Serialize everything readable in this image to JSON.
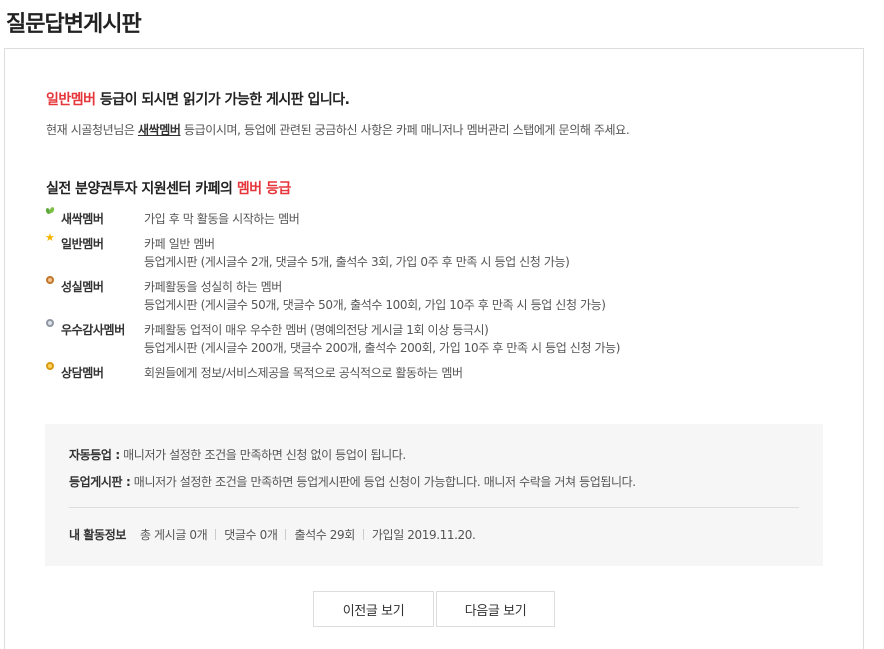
{
  "page": {
    "title": "질문답변게시판"
  },
  "notice": {
    "required_grade": "일반멤버",
    "title_suffix": " 등급이 되시면 읽기가 가능한 게시판 입니다.",
    "desc_prefix": "현재 시골청년님은 ",
    "current_grade": "새싹멤버",
    "desc_suffix": " 등급이시며, 등업에 관련된 궁금하신 사항은 카페 매니저나 멤버관리 스탭에게 문의해 주세요."
  },
  "grades": {
    "title_prefix": "실전 분양권투자 지원센터 카페의 ",
    "title_highlight": "멤버 등급",
    "items": [
      {
        "icon": "sprout-icon",
        "name": "새싹멤버",
        "line1": "가입 후 막 활동을 시작하는 멤버",
        "line2": ""
      },
      {
        "icon": "star-icon",
        "name": "일반멤버",
        "line1": "카페 일반 멤버",
        "line2": "등업게시판 (게시글수 2개, 댓글수 5개, 출석수 3회, 가입 0주 후 만족 시 등업 신청 가능)"
      },
      {
        "icon": "bronze-medal-icon",
        "name": "성실멤버",
        "line1": "카페활동을 성실히 하는 멤버",
        "line2": "등업게시판 (게시글수 50개, 댓글수 50개, 출석수 100회, 가입 10주 후 만족 시 등업 신청 가능)"
      },
      {
        "icon": "silver-medal-icon",
        "name": "우수감사멤버",
        "line1": "카페활동 업적이 매우 우수한 멤버 (명예의전당 게시글 1회 이상 등극시)",
        "line2": "등업게시판 (게시글수 200개, 댓글수 200개, 출석수 200회, 가입 10주 후 만족 시 등업 신청 가능)"
      },
      {
        "icon": "gold-medal-icon",
        "name": "상담멤버",
        "line1": "회원들에게 정보/서비스제공을 목적으로 공식적으로 활동하는 멤버",
        "line2": ""
      }
    ]
  },
  "info": {
    "auto_label": "자동등업 :",
    "auto_text": " 매니저가 설정한 조건을 만족하면 신청 없이 등업이 됩니다.",
    "board_label": "등업게시판 :",
    "board_text": " 매니저가 설정한 조건을 만족하면 등업게시판에 등업 신청이 가능합니다. 매니저 수락을 거쳐 등업됩니다.",
    "activity_label": "내 활동정보",
    "posts": "총 게시글 0개",
    "comments": "댓글수 0개",
    "attendance": "출석수 29회",
    "joined": "가입일 2019.11.20."
  },
  "buttons": {
    "prev": "이전글 보기",
    "next": "다음글 보기"
  }
}
